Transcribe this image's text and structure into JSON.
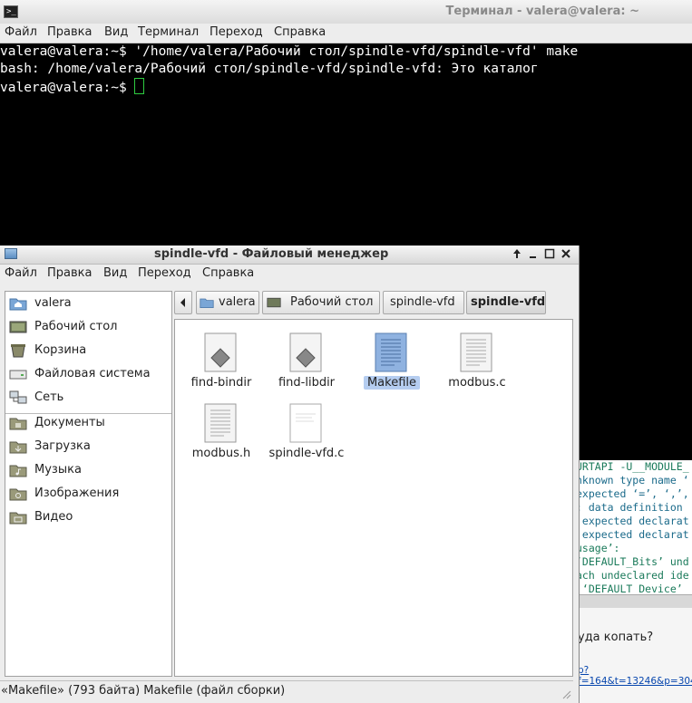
{
  "terminal": {
    "title": "Терминал - valera@valera: ~",
    "menu": [
      "Файл",
      "Правка",
      "Вид",
      "Терминал",
      "Переход",
      "Справка"
    ],
    "lines": [
      "valera@valera:~$ '/home/valera/Рабочий стол/spindle-vfd/spindle-vfd' make",
      "bash: /home/valera/Рабочий стол/spindle-vfd/spindle-vfd: Это каталог",
      "valera@valera:~$ "
    ]
  },
  "background_window": {
    "code_lines": [
      "URTAPI -U__MODULE_",
      "nknown type name ‘",
      "expected ‘=’, ‘,’,",
      ": data definition ",
      " expected declarat",
      " expected declarat",
      "usage’:",
      "‘DEFAULT_Bits’ und",
      "ach undeclared ide",
      " ‘DEFAULT_Device’ "
    ],
    "question": "уда копать?",
    "link": "p?f=164&t=13246&p=3040"
  },
  "file_manager": {
    "title": "spindle-vfd - Файловый менеджер",
    "menu": [
      "Файл",
      "Правка",
      "Вид",
      "Переход",
      "Справка"
    ],
    "sidebar": {
      "places": [
        {
          "label": "valera",
          "icon": "home-folder-icon"
        },
        {
          "label": "Рабочий стол",
          "icon": "desktop-icon"
        },
        {
          "label": "Корзина",
          "icon": "trash-icon"
        },
        {
          "label": "Файловая система",
          "icon": "drive-icon"
        },
        {
          "label": "Сеть",
          "icon": "network-icon"
        }
      ],
      "bookmarks": [
        {
          "label": "Документы",
          "icon": "folder-icon"
        },
        {
          "label": "Загрузка",
          "icon": "folder-icon"
        },
        {
          "label": "Музыка",
          "icon": "folder-icon"
        },
        {
          "label": "Изображения",
          "icon": "folder-icon"
        },
        {
          "label": "Видео",
          "icon": "folder-icon"
        }
      ]
    },
    "pathbar": [
      "valera",
      "Рабочий стол",
      "spindle-vfd",
      "spindle-vfd"
    ],
    "files": [
      {
        "name": "find-bindir",
        "icon": "script-icon",
        "selected": false
      },
      {
        "name": "find-libdir",
        "icon": "script-icon",
        "selected": false
      },
      {
        "name": "Makefile",
        "icon": "text-file-icon",
        "selected": true
      },
      {
        "name": "modbus.c",
        "icon": "text-file-icon",
        "selected": false
      },
      {
        "name": "modbus.h",
        "icon": "text-file-icon",
        "selected": false
      },
      {
        "name": "spindle-vfd.c",
        "icon": "text-file-icon",
        "selected": false
      }
    ],
    "status": "«Makefile» (793 байта) Makefile (файл сборки)"
  },
  "colors": {
    "terminal_bg": "#000000",
    "terminal_fg": "#ffffff",
    "cursor": "#2ecc40",
    "selection": "#b5cdf0",
    "code_text": "#1a7a5a"
  }
}
